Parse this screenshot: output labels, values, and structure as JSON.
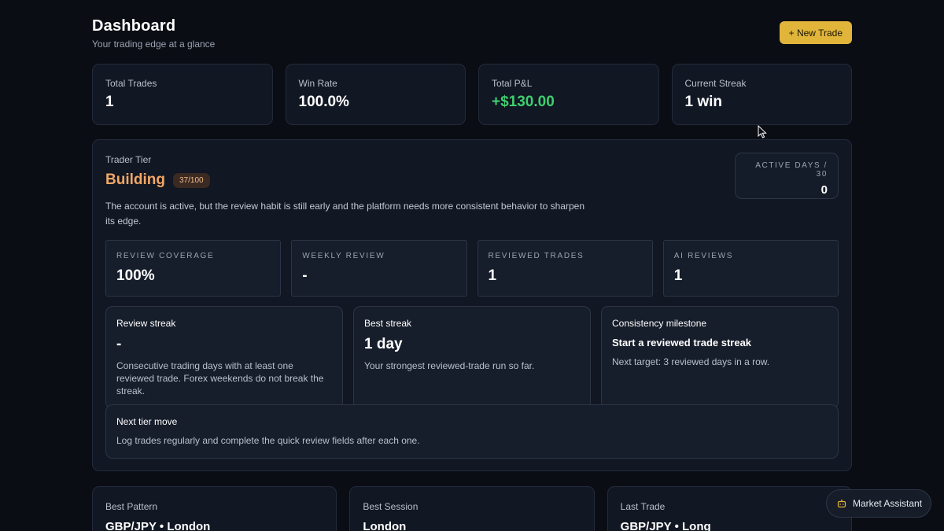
{
  "header": {
    "title": "Dashboard",
    "subtitle": "Your trading edge at a glance",
    "new_trade_label": "+ New Trade"
  },
  "stats": [
    {
      "label": "Total Trades",
      "value": "1"
    },
    {
      "label": "Win Rate",
      "value": "100.0%"
    },
    {
      "label": "Total P&L",
      "value": "+$130.00"
    },
    {
      "label": "Current Streak",
      "value": "1 win"
    }
  ],
  "tier": {
    "label": "Trader Tier",
    "name": "Building",
    "score": "37/100",
    "description": "The account is active, but the review habit is still early and the platform needs more consistent behavior to sharpen its edge.",
    "active_days_label": "ACTIVE DAYS / 30",
    "active_days_value": "0",
    "metrics": [
      {
        "label": "REVIEW COVERAGE",
        "value": "100%"
      },
      {
        "label": "WEEKLY REVIEW",
        "value": "-"
      },
      {
        "label": "REVIEWED TRADES",
        "value": "1"
      },
      {
        "label": "AI REVIEWS",
        "value": "1"
      }
    ],
    "review_streak": {
      "title": "Review streak",
      "value": "-",
      "text": "Consecutive trading days with at least one reviewed trade. Forex weekends do not break the streak."
    },
    "best_streak": {
      "title": "Best streak",
      "value": "1 day",
      "text": "Your strongest reviewed-trade run so far."
    },
    "milestone": {
      "title": "Consistency milestone",
      "headline": "Start a reviewed trade streak",
      "text": "Next target: 3 reviewed days in a row."
    },
    "next_move": {
      "title": "Next tier move",
      "text": "Log trades regularly and complete the quick review fields after each one."
    }
  },
  "bottom": [
    {
      "label": "Best Pattern",
      "value": "GBP/JPY • London"
    },
    {
      "label": "Best Session",
      "value": "London"
    },
    {
      "label": "Last Trade",
      "value": "GBP/JPY • Long"
    }
  ],
  "assistant": {
    "label": "Market Assistant",
    "icon": "robot-icon"
  },
  "colors": {
    "accent": "#e0b53a",
    "positive": "#3ecf6f",
    "tier": "#f3a765"
  }
}
